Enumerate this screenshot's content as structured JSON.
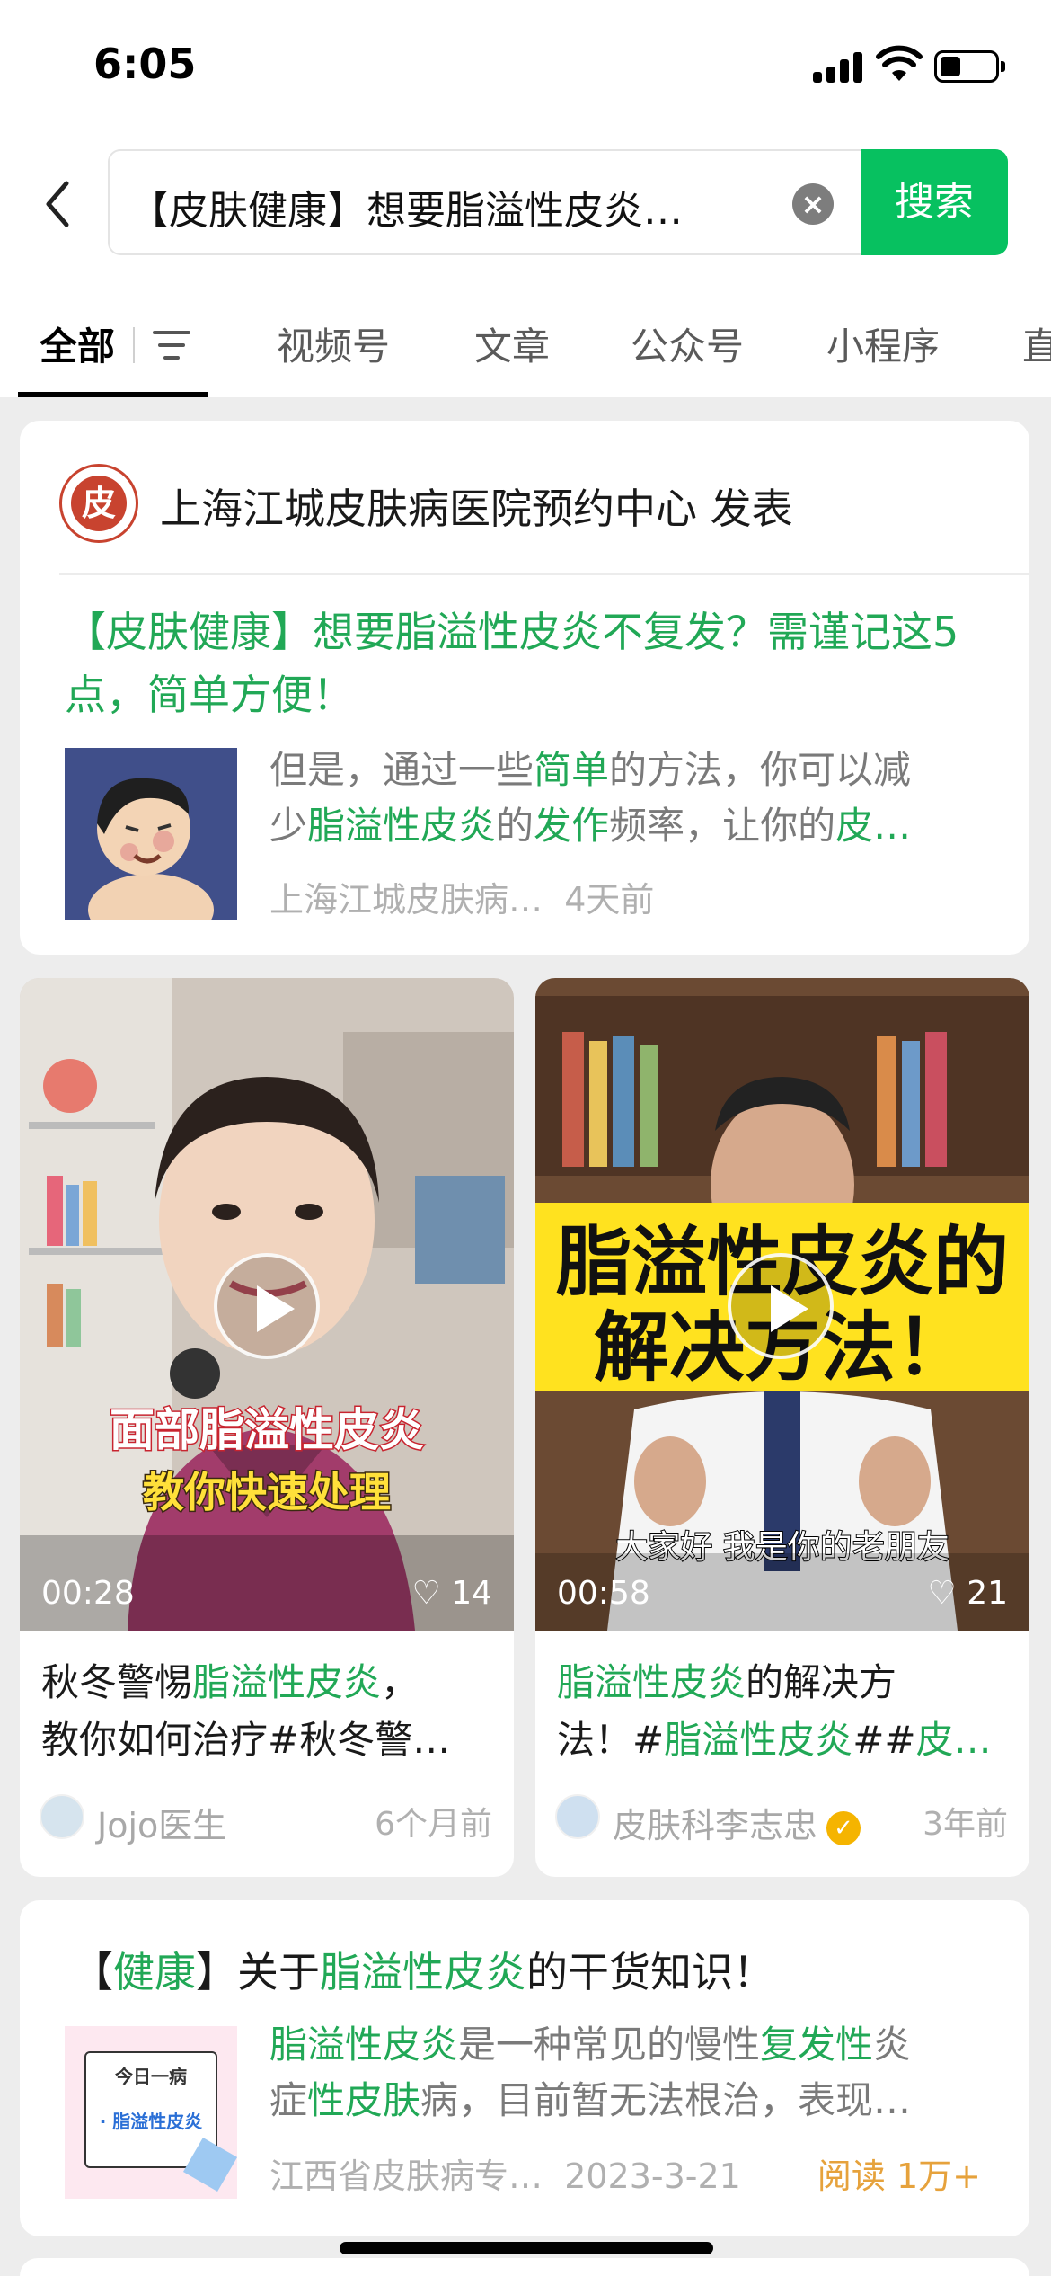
{
  "status_bar": {
    "time": "6:05"
  },
  "search": {
    "query": "【皮肤健康】想要脂溢性皮炎…",
    "button": "搜索"
  },
  "tabs": [
    "全部",
    "视频号",
    "文章",
    "公众号",
    "小程序",
    "直"
  ],
  "article1": {
    "account": "上海江城皮肤病医院预约中心 发表",
    "logo_char": "皮",
    "title": "【皮肤健康】想要脂溢性皮炎不复发？需谨记这5点，简单方便！",
    "desc_line1_a": "但是，通过一些",
    "desc_line1_b": "简单",
    "desc_line1_c": "的方法，你可以减",
    "desc_line2_a": "少",
    "desc_line2_b": "脂溢性皮炎",
    "desc_line2_c": "的",
    "desc_line2_d": "发作",
    "desc_line2_e": "频率，让你的",
    "desc_line2_f": "皮…",
    "source": "上海江城皮肤病…",
    "time": "4天前"
  },
  "video1": {
    "overlay_line1": "面部脂溢性皮炎",
    "overlay_line2": "教你快速处理",
    "duration": "00:28",
    "likes": "14",
    "title_l1_a": "秋冬警惕",
    "title_l1_b": "脂溢性皮炎",
    "title_l1_c": "，",
    "title_l2": "教你如何治疗#秋冬警…",
    "author": "Jojo医生",
    "date": "6个月前"
  },
  "video2": {
    "overlay_line1": "脂溢性皮炎的",
    "overlay_line2": "解决方法！",
    "caption": "大家好 我是你的老朋友",
    "duration": "00:58",
    "likes": "21",
    "title_l1_a": "脂溢性皮炎",
    "title_l1_b": "的解决方",
    "title_l2_a": "法！#",
    "title_l2_b": "脂溢性皮炎",
    "title_l2_c": "##",
    "title_l2_d": "皮…",
    "author": "皮肤科李志忠",
    "verified_mark": "✓",
    "date": "3年前"
  },
  "article2": {
    "title_a": "【",
    "title_b": "健康",
    "title_c": "】关于",
    "title_d": "脂溢性皮炎",
    "title_e": "的干货知识！",
    "thumb_top": "今日一病",
    "thumb_label": "· 脂溢性皮炎",
    "desc_l1_a": "脂溢性皮炎",
    "desc_l1_b": "是一种常见的慢性",
    "desc_l1_c": "复发性",
    "desc_l1_d": "炎",
    "desc_l2_a": "症",
    "desc_l2_b": "性皮肤",
    "desc_l2_c": "病，目前暂无法根治，表现…",
    "source": "江西省皮肤病专…",
    "date": "2023-3-21",
    "reads": "阅读 1万+"
  },
  "colors": {
    "accent": "#07c160",
    "highlight": "#21a856",
    "reads": "#e6a23c"
  }
}
